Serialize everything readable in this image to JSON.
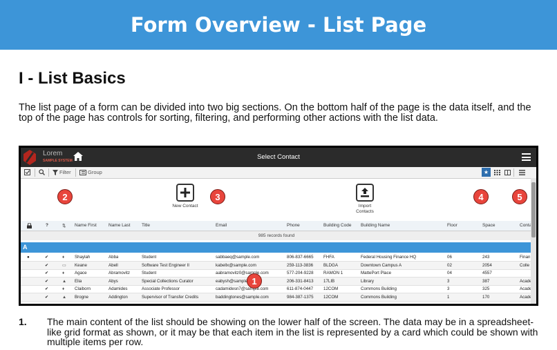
{
  "banner": {
    "title": "Form Overview - List Page"
  },
  "section": {
    "heading": "I - List Basics"
  },
  "intro": "The list page of a form can be divided into two big sections.  On the bottom half of the page is the data itself, and the top of the page has controls for sorting, filtering, and performing other actions with the list data.",
  "app": {
    "logo_name": "Lorem",
    "logo_sub": "SAMPLE SYSTEM",
    "title": "Select Contact",
    "toolbar": {
      "filter": "Filter",
      "group": "Group"
    },
    "actions": {
      "new_contact": "New Contact",
      "import_line1": "Import",
      "import_line2": "Contacts"
    },
    "columns": [
      "Name First",
      "Name Last",
      "Title",
      "Email",
      "Phone",
      "Building Code",
      "Building Name",
      "Floor",
      "Space",
      "Conta"
    ],
    "records_found": "985 records found",
    "group_label": "A",
    "rows": [
      [
        "Shaylah",
        "Abba",
        "Student",
        "sabbaeq@sample.com",
        "806-837-6665",
        "FHFA",
        "Federal Housing Finance HQ",
        "06",
        "243",
        "Finan"
      ],
      [
        "Keane",
        "Abell",
        "Software Test Engineer II",
        "kabellx@sample.com",
        "259-113-3836",
        "BLDGA",
        "Downtown Campus A",
        "02",
        "2054",
        "Colle"
      ],
      [
        "Agace",
        "Abramovitz",
        "Student",
        "aabramovitz0@sample.com",
        "577-204-9228",
        "RAMON 1",
        "MattePort Place",
        "04",
        "4557",
        ""
      ],
      [
        "Elia",
        "Abys",
        "Special Collections Curator",
        "eabysh@sample.com",
        "206-331-8413",
        "17LIB",
        "Library",
        "3",
        "387",
        "Acade"
      ],
      [
        "Claiborn",
        "Adamides",
        "Associate Professor",
        "cadamidesn7@sample.com",
        "611-874-0447",
        "12COM",
        "Commons Building",
        "3",
        "325",
        "Acade"
      ],
      [
        "Brogne",
        "Addington",
        "Supervisor of Transfer Credits",
        "baddingtones@sample.com",
        "984-387-1375",
        "12COM",
        "Commons Building",
        "1",
        "170",
        "Acade"
      ]
    ]
  },
  "markers": {
    "m1": "1",
    "m2": "2",
    "m3": "3",
    "m4": "4",
    "m5": "5"
  },
  "note": {
    "number": "1.",
    "text": "The main content of the list should be showing on the lower half of the screen.  The data may be in a spreadsheet-like grid format as shown, or it may be that each item in the list is represented by a card which could be shown with multiple items per row."
  },
  "colors": {
    "banner": "#3d95d8",
    "navbar": "#2b2b2b",
    "marker": "#e8453c",
    "group_row": "#3d95d8"
  }
}
